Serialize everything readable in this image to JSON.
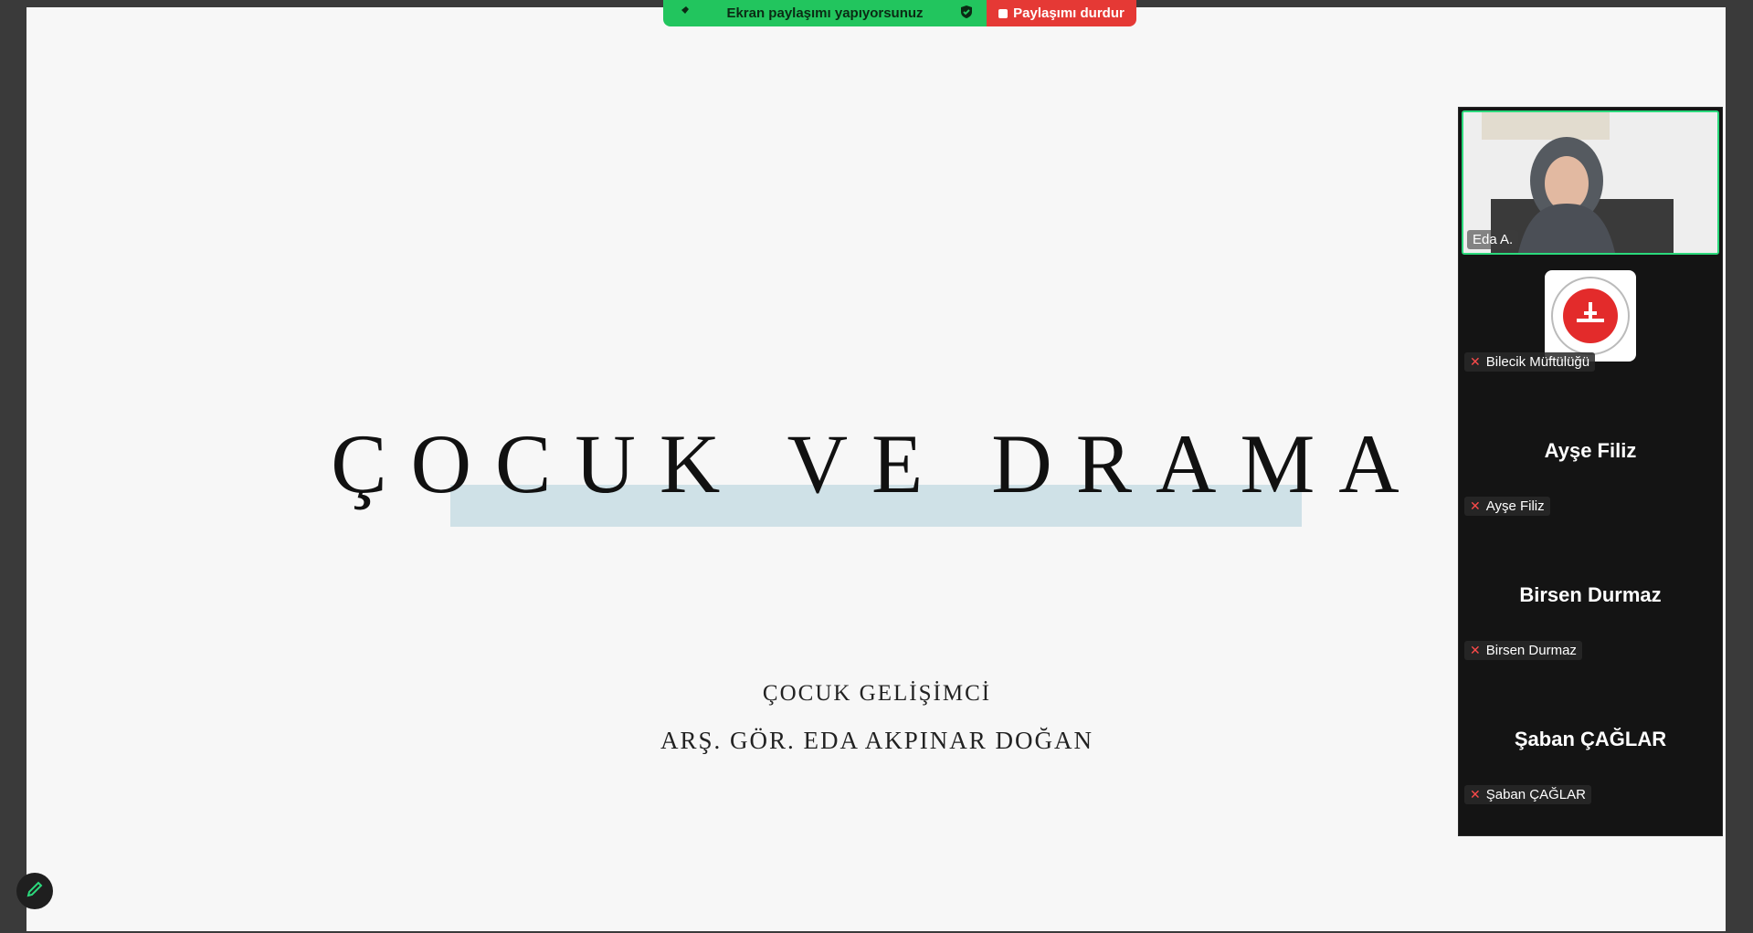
{
  "share_bar": {
    "status_text": "Ekran paylaşımı yapıyorsunuz",
    "stop_label": "Paylaşımı durdur"
  },
  "slide": {
    "title": "ÇOCUK VE DRAMA",
    "subtitle_line1": "ÇOCUK GELİŞİMCİ",
    "subtitle_line2": "ARŞ. GÖR. EDA AKPINAR DOĞAN"
  },
  "participants": {
    "active_speaker": "Eda A.",
    "items": [
      {
        "display": "",
        "label": "Bilecik Müftülüğü",
        "muted": true,
        "has_logo": true
      },
      {
        "display": "Ayşe Filiz",
        "label": "Ayşe Filiz",
        "muted": true
      },
      {
        "display": "Birsen Durmaz",
        "label": "Birsen Durmaz",
        "muted": true
      },
      {
        "display": "Şaban ÇAĞLAR",
        "label": "Şaban ÇAĞLAR",
        "muted": true
      }
    ]
  },
  "colors": {
    "share_green": "#22c55e",
    "stop_red": "#e53935",
    "active_border": "#2bd97c",
    "title_highlight": "#cfe1e7"
  },
  "icons": [
    "pin-icon",
    "shield-check-icon",
    "stop-square-icon",
    "mic-off-icon",
    "annotate-pen-icon"
  ]
}
